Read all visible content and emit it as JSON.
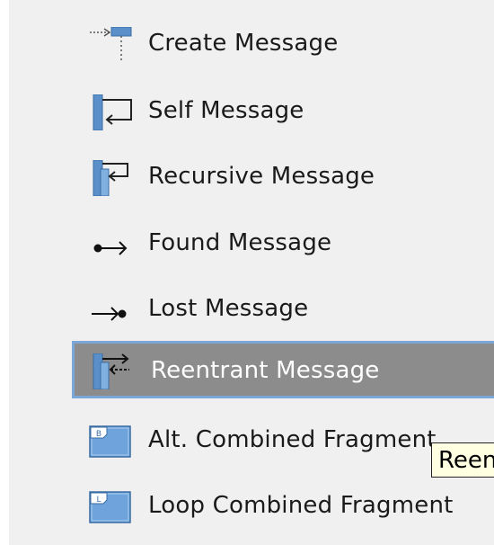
{
  "palette": {
    "items": [
      {
        "label": "Create Message",
        "icon": "create-message-icon"
      },
      {
        "label": "Self Message",
        "icon": "self-message-icon"
      },
      {
        "label": "Recursive Message",
        "icon": "recursive-message-icon"
      },
      {
        "label": "Found Message",
        "icon": "found-message-icon"
      },
      {
        "label": "Lost Message",
        "icon": "lost-message-icon"
      },
      {
        "label": "Reentrant Message",
        "icon": "reentrant-message-icon",
        "selected": true
      },
      {
        "label": "Alt. Combined Fragment",
        "icon": "alt-combined-fragment-icon"
      },
      {
        "label": "Loop Combined Fragment",
        "icon": "loop-combined-fragment-icon"
      }
    ]
  },
  "tooltip": {
    "text": "Reentrant Message"
  },
  "colors": {
    "palette_background": "#f0f0f0",
    "selected_background": "#8c8c8c",
    "selected_border": "#7aa7d8",
    "tooltip_background": "#ffffe1",
    "icon_blue": "#5b8fc9"
  }
}
